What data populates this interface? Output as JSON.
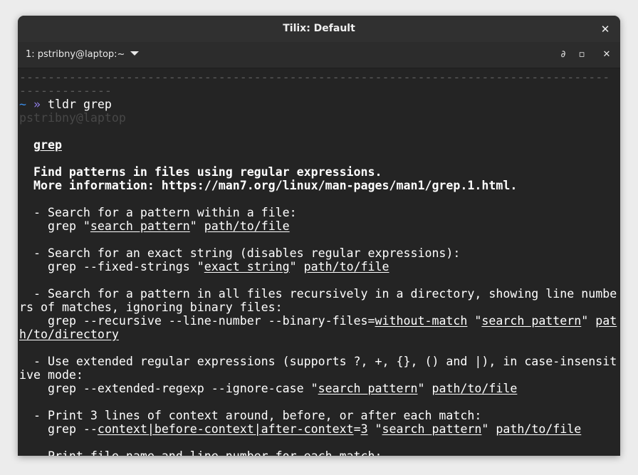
{
  "window": {
    "title": "Tilix: Default",
    "close_glyph": "✕"
  },
  "session": {
    "label": "1: pstribny@laptop:~",
    "split_icon": "∂",
    "maximize_glyph": "▫",
    "close_glyph": "✕"
  },
  "terminal": {
    "dash_line_1": "-----------------------------------------------------------------------------------",
    "dash_line_2": "-------------",
    "prompt_tilde": "~",
    "prompt_arrow": "»",
    "command": "tldr grep",
    "rprompt": "pstribny@laptop",
    "page_title": "grep",
    "desc_line_1": "Find patterns in files using regular expressions.",
    "desc_line_2": "More information: https://man7.org/linux/man-pages/man1/grep.1.html.",
    "ex1": {
      "desc": "- Search for a pattern within a file:",
      "c1": "grep \"",
      "u1": "search pattern",
      "c2": "\" ",
      "u2": "path/to/file"
    },
    "ex2": {
      "desc": "- Search for an exact string (disables regular expressions):",
      "c1": "grep --fixed-strings \"",
      "u1": "exact string",
      "c2": "\" ",
      "u2": "path/to/file"
    },
    "ex3": {
      "desc_a": "- Search for a pattern in all files recursively in a directory, showing line numbe",
      "desc_b": "rs of matches, ignoring binary files:",
      "c1": "grep --recursive --line-number --binary-files=",
      "u1": "without-match",
      "c2": " \"",
      "u2": "search pattern",
      "c3": "\" ",
      "u3a": "pat",
      "u3b": "h/to/directory"
    },
    "ex4": {
      "desc_a": "- Use extended regular expressions (supports ?, +, {}, () and |), in case-insensit",
      "desc_b": "ive mode:",
      "c1": "grep --extended-regexp --ignore-case \"",
      "u1": "search pattern",
      "c2": "\" ",
      "u2": "path/to/file"
    },
    "ex5": {
      "desc": "- Print 3 lines of context around, before, or after each match:",
      "c1": "grep --",
      "u1": "context|before-context|after-context",
      "c2": "=",
      "u2": "3",
      "c3": " \"",
      "u3": "search pattern",
      "c4": "\" ",
      "u4": "path/to/file"
    },
    "ex6": {
      "desc": "- Print file name and line number for each match:"
    }
  },
  "colors": {
    "terminal_bg": "#242424",
    "prompt_tilde": "#3b8eea",
    "prompt_arrow": "#8f7de3",
    "dim": "#474747"
  }
}
